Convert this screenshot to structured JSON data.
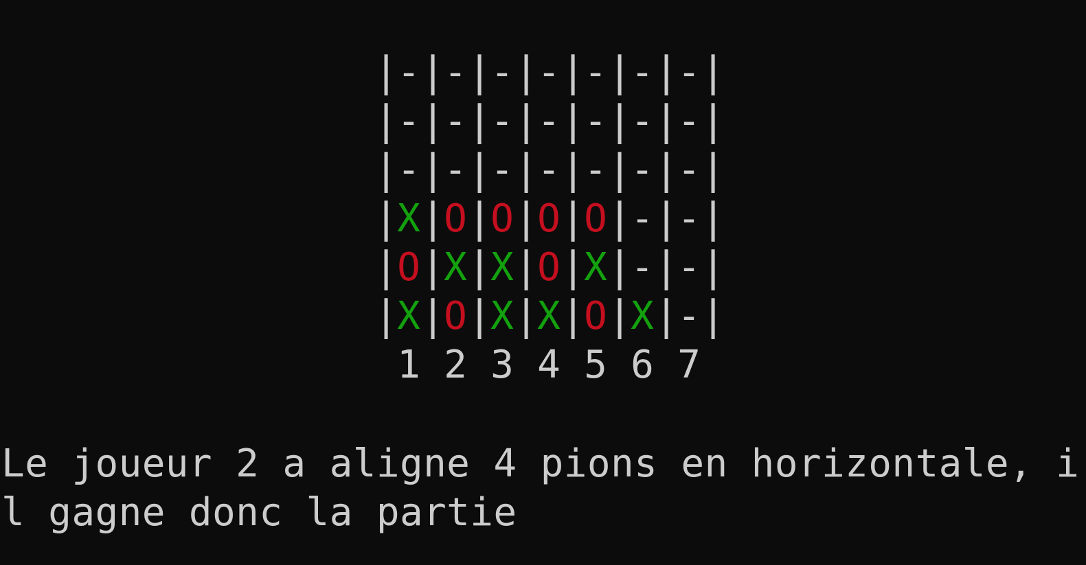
{
  "board": {
    "rows": [
      [
        "-",
        "-",
        "-",
        "-",
        "-",
        "-",
        "-"
      ],
      [
        "-",
        "-",
        "-",
        "-",
        "-",
        "-",
        "-"
      ],
      [
        "-",
        "-",
        "-",
        "-",
        "-",
        "-",
        "-"
      ],
      [
        "X",
        "O",
        "O",
        "O",
        "O",
        "-",
        "-"
      ],
      [
        "O",
        "X",
        "X",
        "O",
        "X",
        "-",
        "-"
      ],
      [
        "X",
        "O",
        "X",
        "X",
        "O",
        "X",
        "-"
      ]
    ],
    "separator": "|",
    "column_labels": [
      "1",
      "2",
      "3",
      "4",
      "5",
      "6",
      "7"
    ]
  },
  "colors": {
    "background": "#0c0c0c",
    "text": "#cccccc",
    "player_x": "#13a10e",
    "player_o": "#c50f1f"
  },
  "message": {
    "line1": "Le joueur 2 a aligne 4 pions en horizontale, i",
    "line2": "l gagne donc la partie"
  }
}
